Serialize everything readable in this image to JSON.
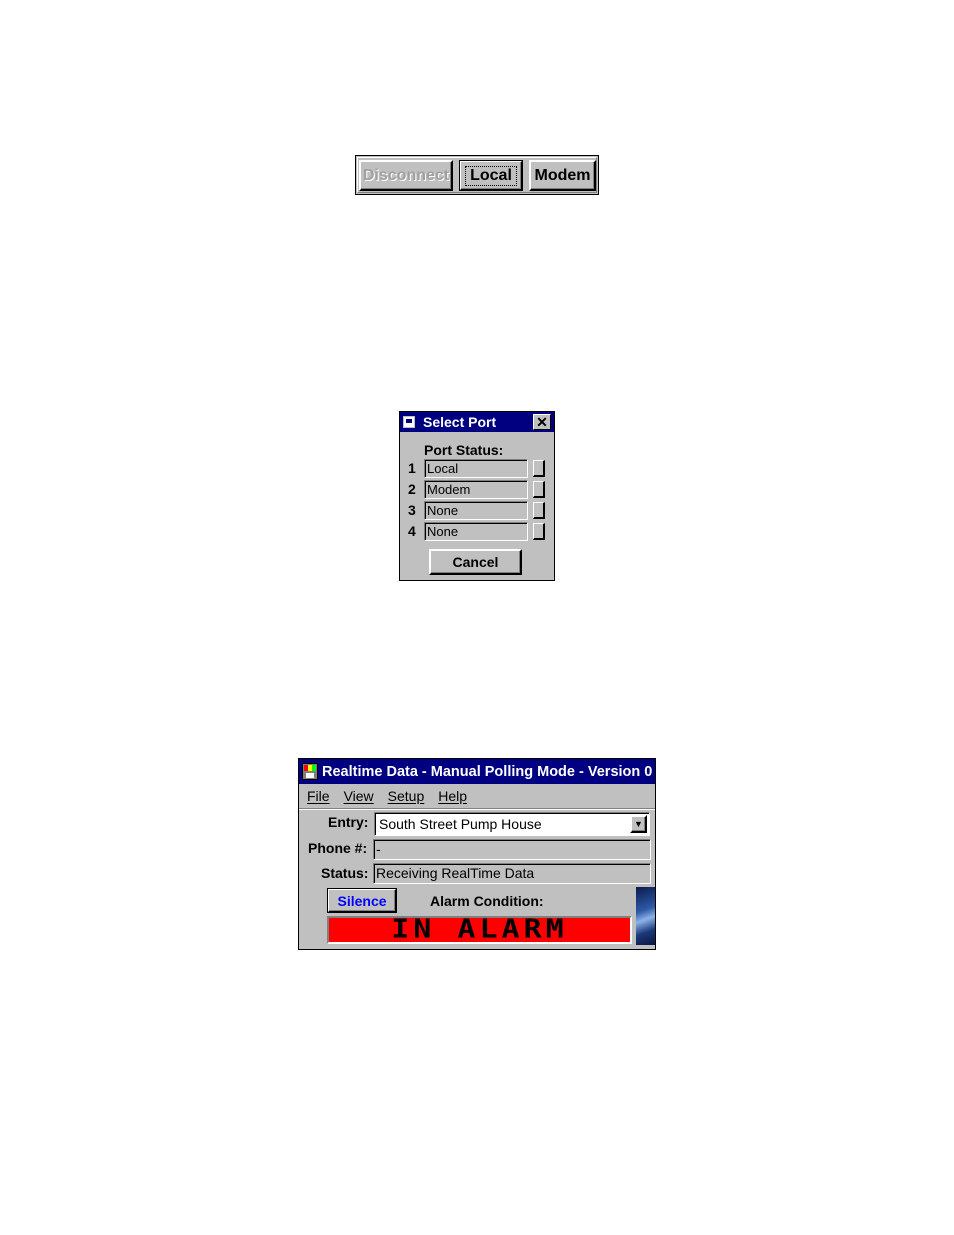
{
  "connection_toolbar": {
    "disconnect_label": "Disconnect",
    "local_label": "Local",
    "modem_label": "Modem"
  },
  "select_port": {
    "title": "Select Port",
    "close_glyph": "✕",
    "port_status_label": "Port Status:",
    "ports": [
      {
        "number": "1",
        "status": "Local"
      },
      {
        "number": "2",
        "status": "Modem"
      },
      {
        "number": "3",
        "status": "None"
      },
      {
        "number": "4",
        "status": "None"
      }
    ],
    "cancel_label": "Cancel"
  },
  "realtime": {
    "title": "Realtime Data - Manual Polling Mode - Version 0",
    "menu": [
      "File",
      "View",
      "Setup",
      "Help"
    ],
    "entry_label": "Entry:",
    "entry_value": "South Street Pump House",
    "dropdown_glyph": "▼",
    "phone_label": "Phone #:",
    "phone_value": "-",
    "status_label": "Status:",
    "status_value": "Receiving RealTime Data",
    "silence_label": "Silence",
    "alarm_condition_label": "Alarm Condition:",
    "alarm_text": "IN ALARM",
    "colors": {
      "titlebar": "#000080",
      "alarm_background": "#ff0000",
      "silence_text": "#0000ff"
    }
  }
}
